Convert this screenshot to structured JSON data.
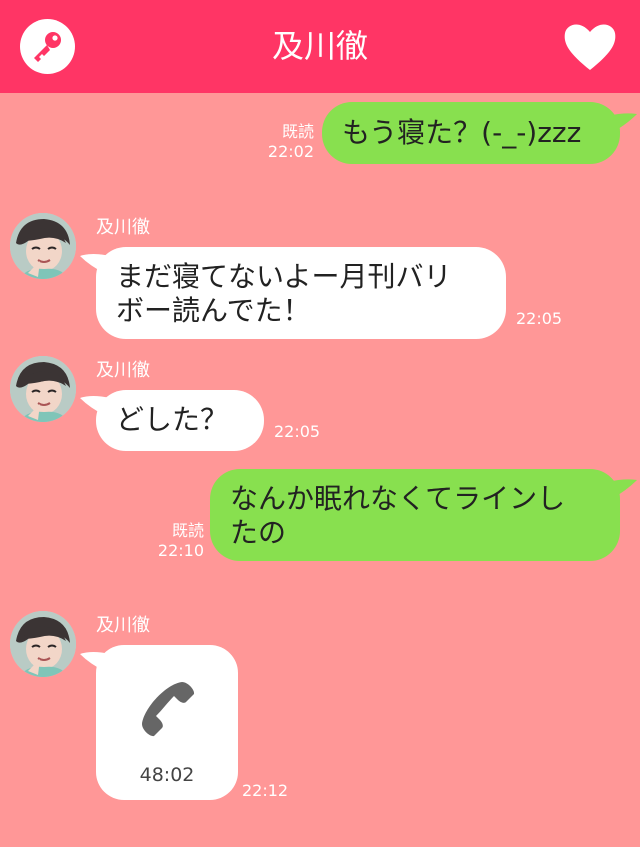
{
  "header": {
    "title": "及川徹",
    "left_icon": "key-icon",
    "right_icon": "heart-icon"
  },
  "colors": {
    "header": "#ff3565",
    "background": "#ff9797",
    "green_bubble": "#88e04f",
    "white_bubble": "#ffffff"
  },
  "messages": [
    {
      "side": "right",
      "read_label": "既読",
      "time": "22:02",
      "text": "もう寝た？(-_-)zzz"
    },
    {
      "side": "left",
      "sender": "及川徹",
      "time": "22:05",
      "line1": "まだ寝てないよー月刊バリ",
      "line2": "ボー読んでた！"
    },
    {
      "side": "left",
      "sender": "及川徹",
      "time": "22:05",
      "text": "どした？"
    },
    {
      "side": "right",
      "read_label": "既読",
      "time": "22:10",
      "line1": "なんか眠れなくてラインし",
      "line2": "たの"
    },
    {
      "side": "left",
      "sender": "及川徹",
      "time": "22:12",
      "call_icon": "phone-icon",
      "duration": "48:02"
    }
  ]
}
